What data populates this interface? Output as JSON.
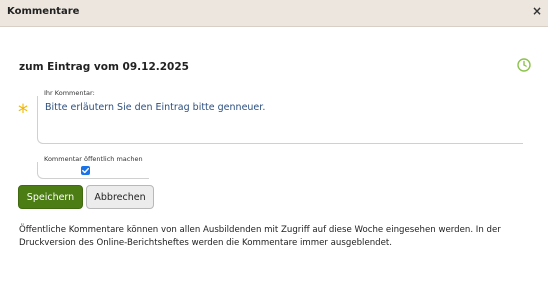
{
  "dialog": {
    "title": "Kommentare",
    "close_glyph": "×"
  },
  "heading": "zum Eintrag vom 09.12.2025",
  "icons": {
    "clock": "clock-icon",
    "required": "required-asterisk-icon",
    "accent_color": "#f2b600"
  },
  "comment": {
    "label": "Ihr Kommentar:",
    "value": "Bitte erläutern Sie den Eintrag bitte genneuer.",
    "required_glyph": "*"
  },
  "public_toggle": {
    "label": "Kommentar öffentlich machen",
    "checked": true
  },
  "buttons": {
    "save_label": "Speichern",
    "cancel_label": "Abbrechen",
    "save_color": "#4c7c14"
  },
  "info_text": "Öffentliche Kommentare können von allen Ausbildenden mit Zugriff auf diese Woche eingesehen werden. In der Druckversion des Online-Berichtsheftes werden die Kommentare immer ausgeblendet."
}
